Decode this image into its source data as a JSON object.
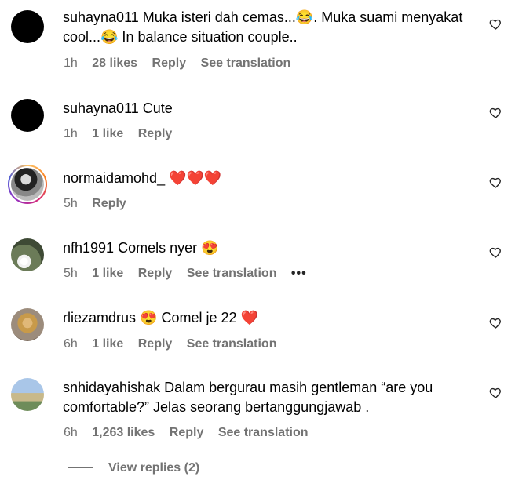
{
  "comments": [
    {
      "username": "suhayna011",
      "text": "Muka isteri dah cemas...😂. Muka suami menyakat cool...😂 In balance situation couple..",
      "time": "1h",
      "likes": "28 likes",
      "reply": "Reply",
      "translate": "See translation"
    },
    {
      "username": "suhayna011",
      "text": "Cute",
      "time": "1h",
      "likes": "1 like",
      "reply": "Reply"
    },
    {
      "username": "normaidamohd_",
      "text": "❤️❤️❤️",
      "time": "5h",
      "reply": "Reply"
    },
    {
      "username": "nfh1991",
      "text": "Comels nyer 😍",
      "time": "5h",
      "likes": "1 like",
      "reply": "Reply",
      "translate": "See translation",
      "more": "•••"
    },
    {
      "username": "rliezamdrus",
      "text": "😍 Comel je 22 ❤️",
      "time": "6h",
      "likes": "1 like",
      "reply": "Reply",
      "translate": "See translation"
    },
    {
      "username": "snhidayahishak",
      "text": "Dalam bergurau masih gentleman “are you comfortable?” Jelas seorang bertanggungjawab .",
      "time": "6h",
      "likes": "1,263 likes",
      "reply": "Reply",
      "translate": "See translation"
    }
  ],
  "view_replies": "View replies (2)",
  "icons": {
    "like": "heart-outline-icon",
    "more": "ellipsis-icon"
  }
}
